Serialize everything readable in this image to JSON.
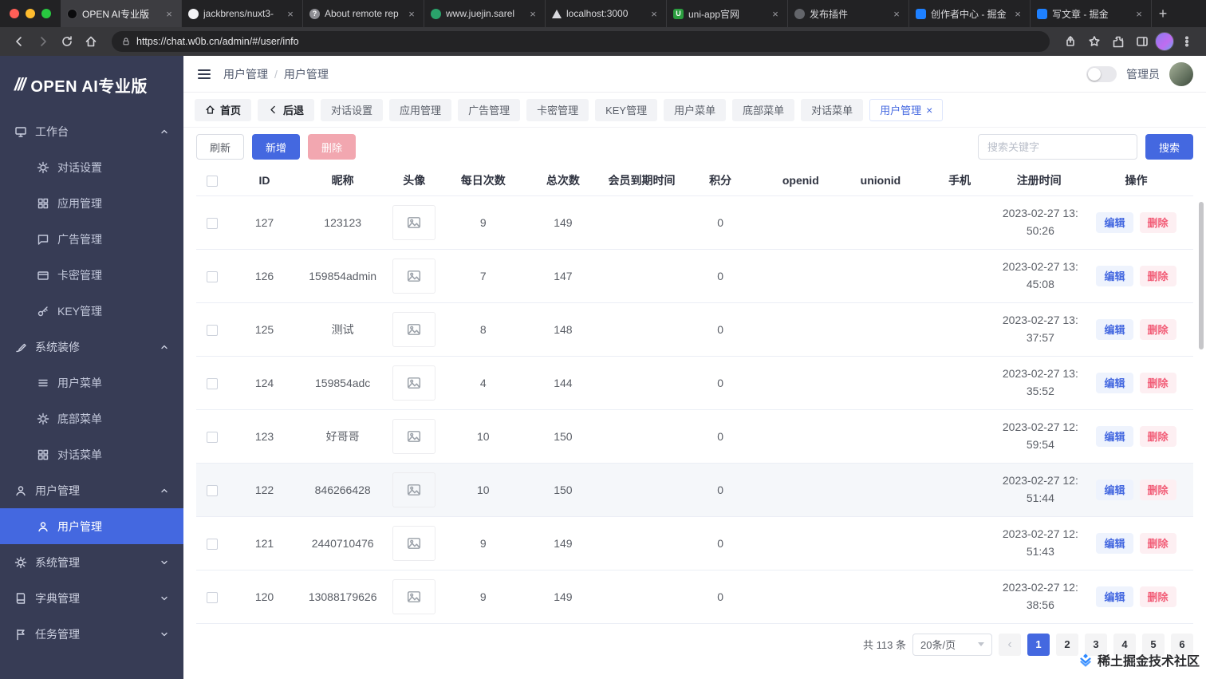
{
  "browser": {
    "tabs": [
      {
        "title": "OPEN AI专业版"
      },
      {
        "title": "jackbrens/nuxt3-"
      },
      {
        "title": "About remote rep"
      },
      {
        "title": "www.juejin.sarel"
      },
      {
        "title": "localhost:3000"
      },
      {
        "title": "uni-app官网"
      },
      {
        "title": "发布插件"
      },
      {
        "title": "创作者中心 - 掘金"
      },
      {
        "title": "写文章 - 掘金"
      }
    ],
    "url": "https://chat.w0b.cn/admin/#/user/info"
  },
  "sidebar": {
    "logo_mark": "///",
    "logo_text": "OPEN AI专业版",
    "groups": [
      {
        "label": "工作台",
        "items": [
          "对话设置",
          "应用管理",
          "广告管理",
          "卡密管理",
          "KEY管理"
        ]
      },
      {
        "label": "系统装修",
        "items": [
          "用户菜单",
          "底部菜单",
          "对话菜单"
        ]
      },
      {
        "label": "用户管理",
        "items": [
          "用户管理"
        ]
      },
      {
        "label": "系统管理",
        "items": []
      },
      {
        "label": "字典管理",
        "items": []
      },
      {
        "label": "任务管理",
        "items": []
      }
    ]
  },
  "header": {
    "breadcrumb_parent": "用户管理",
    "breadcrumb_current": "用户管理",
    "username": "管理员"
  },
  "tabbar": {
    "home": "首页",
    "back": "后退",
    "items": [
      "对话设置",
      "应用管理",
      "广告管理",
      "卡密管理",
      "KEY管理",
      "用户菜单",
      "底部菜单",
      "对话菜单"
    ],
    "active": "用户管理"
  },
  "toolbar": {
    "refresh": "刷新",
    "add": "新增",
    "delete": "删除",
    "search_placeholder": "搜索关键字",
    "search": "搜索"
  },
  "table": {
    "columns": [
      "ID",
      "昵称",
      "头像",
      "每日次数",
      "总次数",
      "会员到期时间",
      "积分",
      "openid",
      "unionid",
      "手机",
      "注册时间",
      "操作"
    ],
    "edit_label": "编辑",
    "delete_label": "删除",
    "rows": [
      {
        "id": "127",
        "nickname": "123123",
        "daily": "9",
        "total": "149",
        "vip_expire": "",
        "points": "0",
        "openid": "",
        "unionid": "",
        "phone": "",
        "registered": "2023-02-27 13:50:26"
      },
      {
        "id": "126",
        "nickname": "159854admin",
        "daily": "7",
        "total": "147",
        "vip_expire": "",
        "points": "0",
        "openid": "",
        "unionid": "",
        "phone": "",
        "registered": "2023-02-27 13:45:08"
      },
      {
        "id": "125",
        "nickname": "测试",
        "daily": "8",
        "total": "148",
        "vip_expire": "",
        "points": "0",
        "openid": "",
        "unionid": "",
        "phone": "",
        "registered": "2023-02-27 13:37:57"
      },
      {
        "id": "124",
        "nickname": "159854adc",
        "daily": "4",
        "total": "144",
        "vip_expire": "",
        "points": "0",
        "openid": "",
        "unionid": "",
        "phone": "",
        "registered": "2023-02-27 13:35:52"
      },
      {
        "id": "123",
        "nickname": "好哥哥",
        "daily": "10",
        "total": "150",
        "vip_expire": "",
        "points": "0",
        "openid": "",
        "unionid": "",
        "phone": "",
        "registered": "2023-02-27 12:59:54"
      },
      {
        "id": "122",
        "nickname": "846266428",
        "daily": "10",
        "total": "150",
        "vip_expire": "",
        "points": "0",
        "openid": "",
        "unionid": "",
        "phone": "",
        "registered": "2023-02-27 12:51:44"
      },
      {
        "id": "121",
        "nickname": "2440710476",
        "daily": "9",
        "total": "149",
        "vip_expire": "",
        "points": "0",
        "openid": "",
        "unionid": "",
        "phone": "",
        "registered": "2023-02-27 12:51:43"
      },
      {
        "id": "120",
        "nickname": "13088179626",
        "daily": "9",
        "total": "149",
        "vip_expire": "",
        "points": "0",
        "openid": "",
        "unionid": "",
        "phone": "",
        "registered": "2023-02-27 12:38:56"
      }
    ]
  },
  "pagination": {
    "total": "共 113 条",
    "page_size": "20条/页",
    "pages": [
      "1",
      "2",
      "3",
      "4",
      "5",
      "6"
    ],
    "active_page": "1"
  },
  "watermark": {
    "text": "稀土掘金技术社区"
  },
  "colors": {
    "primary": "#4468e0",
    "sidebar_bg": "#373c55",
    "danger": "#f56c6c",
    "disabled_danger": "#f2a7b0"
  }
}
